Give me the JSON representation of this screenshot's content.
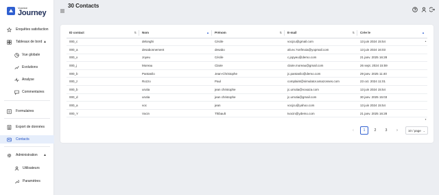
{
  "brand": {
    "small": "Voxeize",
    "big": "Journey"
  },
  "sidebar": {
    "items": [
      {
        "label": "Enquêtes satisfaction",
        "icon": "star-icon"
      },
      {
        "label": "Tableaux de bord",
        "icon": "dashboard-icon",
        "chevron": "▲"
      },
      {
        "label": "Vue globale",
        "icon": "pie-chart-icon"
      },
      {
        "label": "Evolutions",
        "icon": "trend-icon"
      },
      {
        "label": "Analyse",
        "icon": "pulse-icon"
      },
      {
        "label": "Commentaires",
        "icon": "comment-icon"
      },
      {
        "label": "Formulaires",
        "icon": "forms-icon"
      },
      {
        "label": "Export de données",
        "icon": "export-icon"
      },
      {
        "label": "Contacts",
        "icon": "contacts-icon"
      },
      {
        "label": "Administration",
        "icon": "settings-icon",
        "chevron": "▲"
      },
      {
        "label": "Utilisateurs",
        "icon": "user-icon"
      },
      {
        "label": "Paramètres",
        "icon": "wrench-icon"
      }
    ]
  },
  "header": {
    "title": "30 Contacts"
  },
  "table": {
    "columns": [
      "ID contact",
      "Nom",
      "Prénom",
      "E-mail",
      "Crée le"
    ],
    "rows": [
      [
        "000_c",
        "delonghi",
        "Cécile",
        "vocjcu@gmail.com",
        "13 juin 2024 15:54"
      ],
      [
        "000_a",
        "desabonnement",
        "desabo",
        "alt.ex.?onfmoia@yopmail.com",
        "13 juin 2024 16:03"
      ],
      [
        "000_x",
        "Joyeu",
        "Cécile",
        "c.jopyeu@demo.com",
        "21 janv. 2025 16:28"
      ],
      [
        "000_j",
        "Moreau",
        "Claire",
        "claire.moreau@gmail.com",
        "26 sept. 2024 15:59"
      ],
      [
        "000_b",
        "Pantanilo",
        "Jean-Christophe",
        "jc.pantanilo@demo.com",
        "29 janv. 2025 11:40"
      ],
      [
        "000_z",
        "Rozzo",
        "Paul",
        "complaint@simulator.amazonses.com",
        "23 oct. 2024 11:01"
      ],
      [
        "000_b",
        "urutia",
        "jean christophe",
        "jc.urrutia@voxaza.com",
        "13 juin 2024 15:54"
      ],
      [
        "000_d",
        "urutia",
        "jean christophe",
        "jc.urrutia@gmail.com",
        "30 janv. 2025 15:03"
      ],
      [
        "000_a",
        "voc",
        "jean",
        "vocjcu@yahoo.com",
        "13 juin 2024 15:54"
      ],
      [
        "000_Y",
        "Vocin",
        "Thibault",
        "tvocin@ydemo.com",
        "21 janv. 2025 16:28"
      ]
    ]
  },
  "pagination": {
    "prev": "‹",
    "pages": [
      "1",
      "2",
      "3"
    ],
    "next": "›",
    "per_page": "10 / page"
  },
  "colors": {
    "accent": "#2f5fd0",
    "sidebar_active_bg": "#e6eefb"
  }
}
